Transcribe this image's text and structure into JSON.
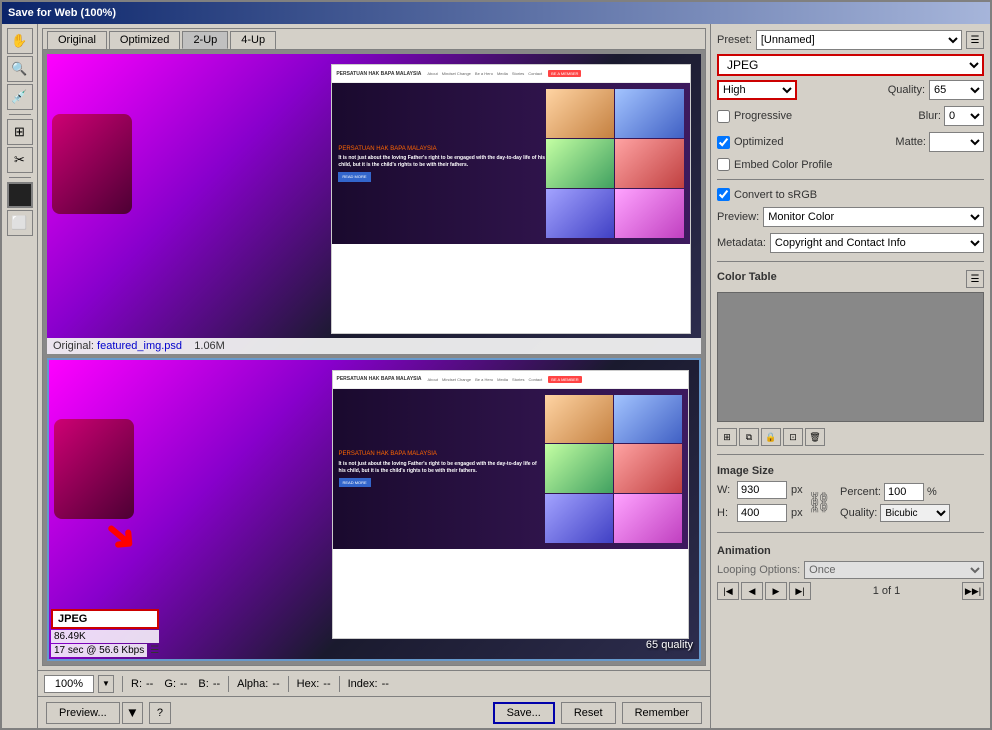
{
  "window": {
    "title": "Save for Web (100%)"
  },
  "tabs": {
    "original": "Original",
    "optimized": "Optimized",
    "two_up": "2-Up",
    "four_up": "4-Up"
  },
  "toolbar": {
    "tools": [
      "hand",
      "zoom",
      "eyedropper",
      "toggle-slice",
      "slice"
    ]
  },
  "right_panel": {
    "preset_label": "Preset:",
    "preset_value": "[Unnamed]",
    "format_value": "JPEG",
    "quality_level": "High",
    "quality_value": "65",
    "blur_label": "Blur:",
    "blur_value": "0",
    "progressive_label": "Progressive",
    "optimized_label": "Optimized",
    "matte_label": "Matte:",
    "embed_color_profile_label": "Embed Color Profile",
    "convert_srgb_label": "Convert to sRGB",
    "preview_label": "Preview:",
    "preview_value": "Monitor Color",
    "metadata_label": "Metadata:",
    "metadata_value": "Copyright and Contact Info",
    "color_table_label": "Color Table",
    "image_size_label": "Image Size",
    "width_label": "W:",
    "width_value": "930",
    "height_label": "H:",
    "height_value": "400",
    "px_label": "px",
    "percent_label": "Percent:",
    "percent_value": "100",
    "quality_resample_label": "Quality:",
    "quality_resample_value": "Bicubic",
    "animation_label": "Animation",
    "looping_label": "Looping Options:",
    "looping_value": "Once",
    "frame_count": "1 of 1"
  },
  "image_info": {
    "original_label": "Original:",
    "original_filename": "featured_img.psd",
    "original_size": "1.06M",
    "format_label": "JPEG",
    "file_size": "86.49K",
    "time_info": "17 sec @ 56.6 Kbps",
    "quality_display": "65 quality"
  },
  "status_bar": {
    "zoom_value": "100%",
    "r_label": "R:",
    "r_value": "--",
    "g_label": "G:",
    "g_value": "--",
    "b_label": "B:",
    "b_value": "--",
    "alpha_label": "Alpha:",
    "alpha_value": "--",
    "hex_label": "Hex:",
    "hex_value": "--",
    "index_label": "Index:",
    "index_value": "--"
  },
  "action_bar": {
    "preview_label": "Preview...",
    "save_label": "Save...",
    "reset_label": "Reset",
    "remember_label": "Remember"
  }
}
